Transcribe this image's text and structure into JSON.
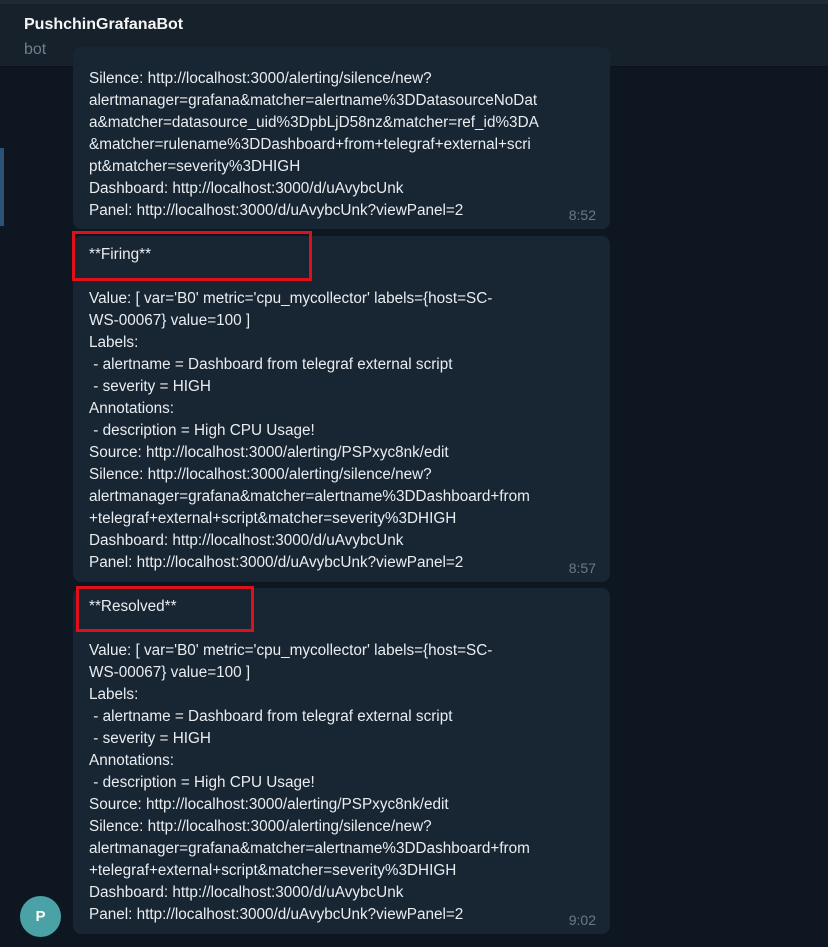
{
  "chat": {
    "title": "PushchinGrafanaBot",
    "subtitle": "bot"
  },
  "avatar": {
    "letter": "P",
    "color": "#4aa2a6"
  },
  "messages": [
    {
      "text": "Silence: http://localhost:3000/alerting/silence/new?\nalertmanager=grafana&matcher=alertname%3DDatasourceNoDat\na&matcher=datasource_uid%3DpbLjD58nz&matcher=ref_id%3DA\n&matcher=rulename%3DDashboard+from+telegraf+external+scri\npt&matcher=severity%3DHIGH\nDashboard: http://localhost:3000/d/uAvybcUnk\nPanel: http://localhost:3000/d/uAvybcUnk?viewPanel=2",
      "time": "8:52"
    },
    {
      "text": "**Firing**\n\nValue: [ var='B0' metric='cpu_mycollector' labels={host=SC-\nWS-00067} value=100 ]\nLabels:\n - alertname = Dashboard from telegraf external script\n - severity = HIGH\nAnnotations:\n - description = High CPU Usage!\nSource: http://localhost:3000/alerting/PSPxyc8nk/edit\nSilence: http://localhost:3000/alerting/silence/new?\nalertmanager=grafana&matcher=alertname%3DDashboard+from\n+telegraf+external+script&matcher=severity%3DHIGH\nDashboard: http://localhost:3000/d/uAvybcUnk\nPanel: http://localhost:3000/d/uAvybcUnk?viewPanel=2",
      "time": "8:57"
    },
    {
      "text": "**Resolved**\n\nValue: [ var='B0' metric='cpu_mycollector' labels={host=SC-\nWS-00067} value=100 ]\nLabels:\n - alertname = Dashboard from telegraf external script\n - severity = HIGH\nAnnotations:\n - description = High CPU Usage!\nSource: http://localhost:3000/alerting/PSPxyc8nk/edit\nSilence: http://localhost:3000/alerting/silence/new?\nalertmanager=grafana&matcher=alertname%3DDashboard+from\n+telegraf+external+script&matcher=severity%3DHIGH\nDashboard: http://localhost:3000/d/uAvybcUnk\nPanel: http://localhost:3000/d/uAvybcUnk?viewPanel=2",
      "time": "9:02"
    }
  ],
  "colors": {
    "background": "#0e1621",
    "header": "#17212b",
    "bubble": "#182533",
    "text": "#e9edf0",
    "time": "#6c7883",
    "highlight": "#e0101a"
  }
}
